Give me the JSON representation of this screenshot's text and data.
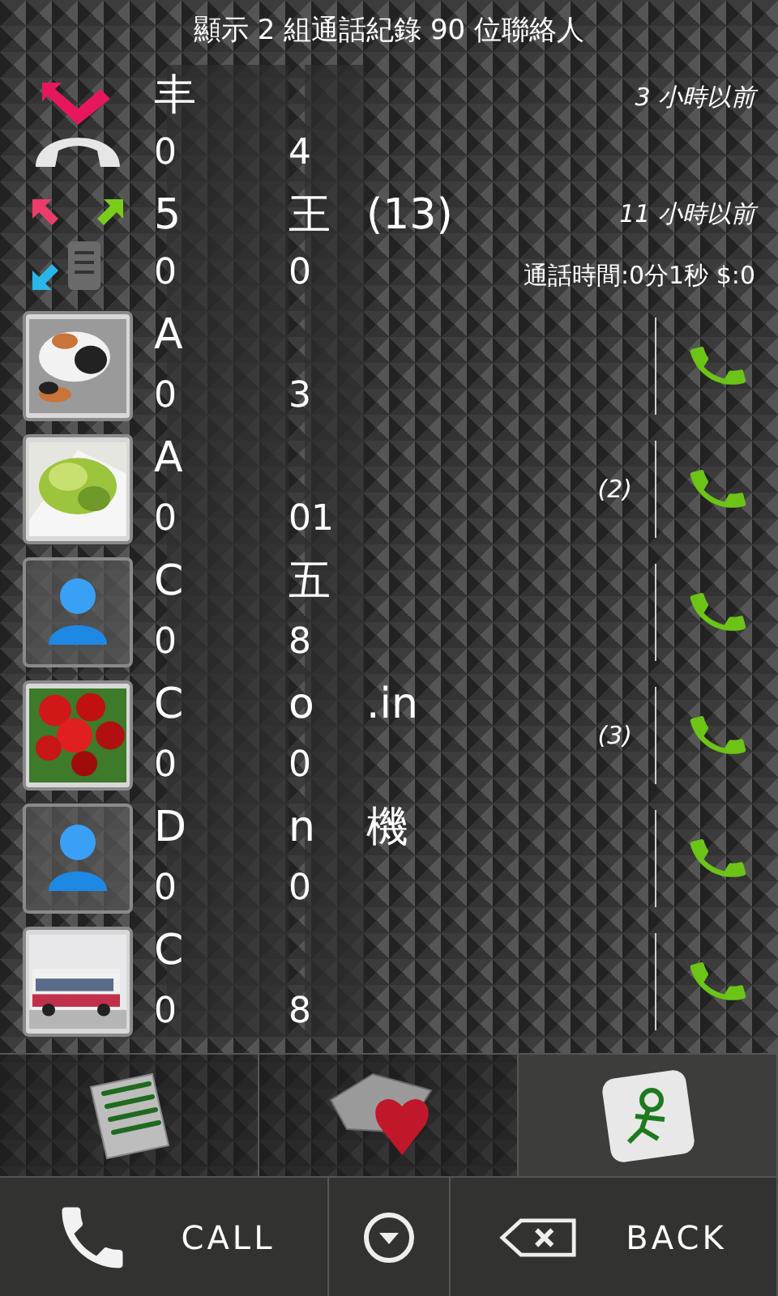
{
  "header": {
    "title": "顯示 2 組通話紀錄 90 位聯絡人"
  },
  "groups": [
    {
      "kind": "missed",
      "name_parts": [
        "丰"
      ],
      "number_parts": [
        "0",
        "4"
      ],
      "time": "3 小時以前"
    },
    {
      "kind": "mixed",
      "name_parts": [
        "5",
        "王",
        "(13)"
      ],
      "number_parts": [
        "0",
        "0"
      ],
      "time": "11 小時以前",
      "duration": "通話時間:0分1秒 $:0"
    }
  ],
  "contacts": [
    {
      "name_parts": [
        "A"
      ],
      "number_parts": [
        "0",
        "3"
      ]
    },
    {
      "name_parts": [
        "A"
      ],
      "number_parts": [
        "0",
        "01"
      ],
      "count": "(2)"
    },
    {
      "kind": "default",
      "name_parts": [
        "C",
        "五"
      ],
      "number_parts": [
        "0",
        "8"
      ]
    },
    {
      "name_parts": [
        "C",
        "o",
        ".in"
      ],
      "number_parts": [
        "0",
        "0"
      ],
      "count": "(3)"
    },
    {
      "kind": "default",
      "name_parts": [
        "D",
        "n",
        "機"
      ],
      "number_parts": [
        "0",
        "0"
      ]
    },
    {
      "name_parts": [
        "C"
      ],
      "number_parts": [
        "0",
        "8"
      ]
    }
  ],
  "tabs": [
    {
      "kind": "notes",
      "selected": false
    },
    {
      "kind": "favorites",
      "selected": false
    },
    {
      "kind": "runner",
      "selected": true
    }
  ],
  "buttons": [
    {
      "kind": "call",
      "label": "CALL"
    },
    {
      "kind": "menu"
    },
    {
      "kind": "back",
      "label": "BACK"
    }
  ]
}
